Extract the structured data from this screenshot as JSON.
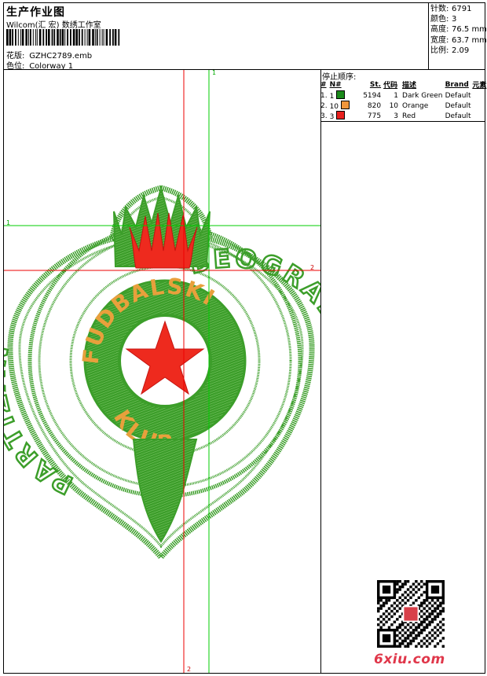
{
  "header": {
    "title": "生产作业图",
    "subtitle": "Wilcom(汇 宏) 数绣工作室",
    "design_label": "花版:",
    "design_value": "GZHC2789.emb",
    "colorway_label": "色位:",
    "colorway_value": "Colorway 1"
  },
  "stats": [
    {
      "label": "针数:",
      "value": "6791"
    },
    {
      "label": "颜色:",
      "value": "3"
    },
    {
      "label": "高度:",
      "value": "76.5 mm"
    },
    {
      "label": "宽度:",
      "value": "63.7 mm"
    },
    {
      "label": "比例:",
      "value": "2.09"
    }
  ],
  "stop_sequence": {
    "title": "停止顺序:",
    "headers": [
      "#",
      "N#",
      "St.",
      "代码",
      "描述",
      "Brand",
      "元素"
    ],
    "rows": [
      {
        "num": "1.",
        "n": "1",
        "color": "#1a8a1a",
        "stitches": "5194",
        "code": "1",
        "desc": "Dark Green",
        "brand": "Default"
      },
      {
        "num": "2.",
        "n": "10",
        "color": "#f0963c",
        "stitches": "820",
        "code": "10",
        "desc": "Orange",
        "brand": "Default"
      },
      {
        "num": "3.",
        "n": "3",
        "color": "#e8201e",
        "stitches": "775",
        "code": "3",
        "desc": "Red",
        "brand": "Default"
      }
    ]
  },
  "guides": {
    "green_v_label": "1",
    "green_h_label": "1",
    "red_h_label": "2",
    "red_v_label": "2"
  },
  "emblem": {
    "top_text": "FUDBALSKI",
    "bottom_text": "KLUB",
    "left_text": "PARTIZAN",
    "right_text": "BEOGRAD",
    "green": "#3c9e2a",
    "orange": "#e8a03c",
    "red": "#ee2a1e"
  },
  "watermark": "6xiu.com"
}
